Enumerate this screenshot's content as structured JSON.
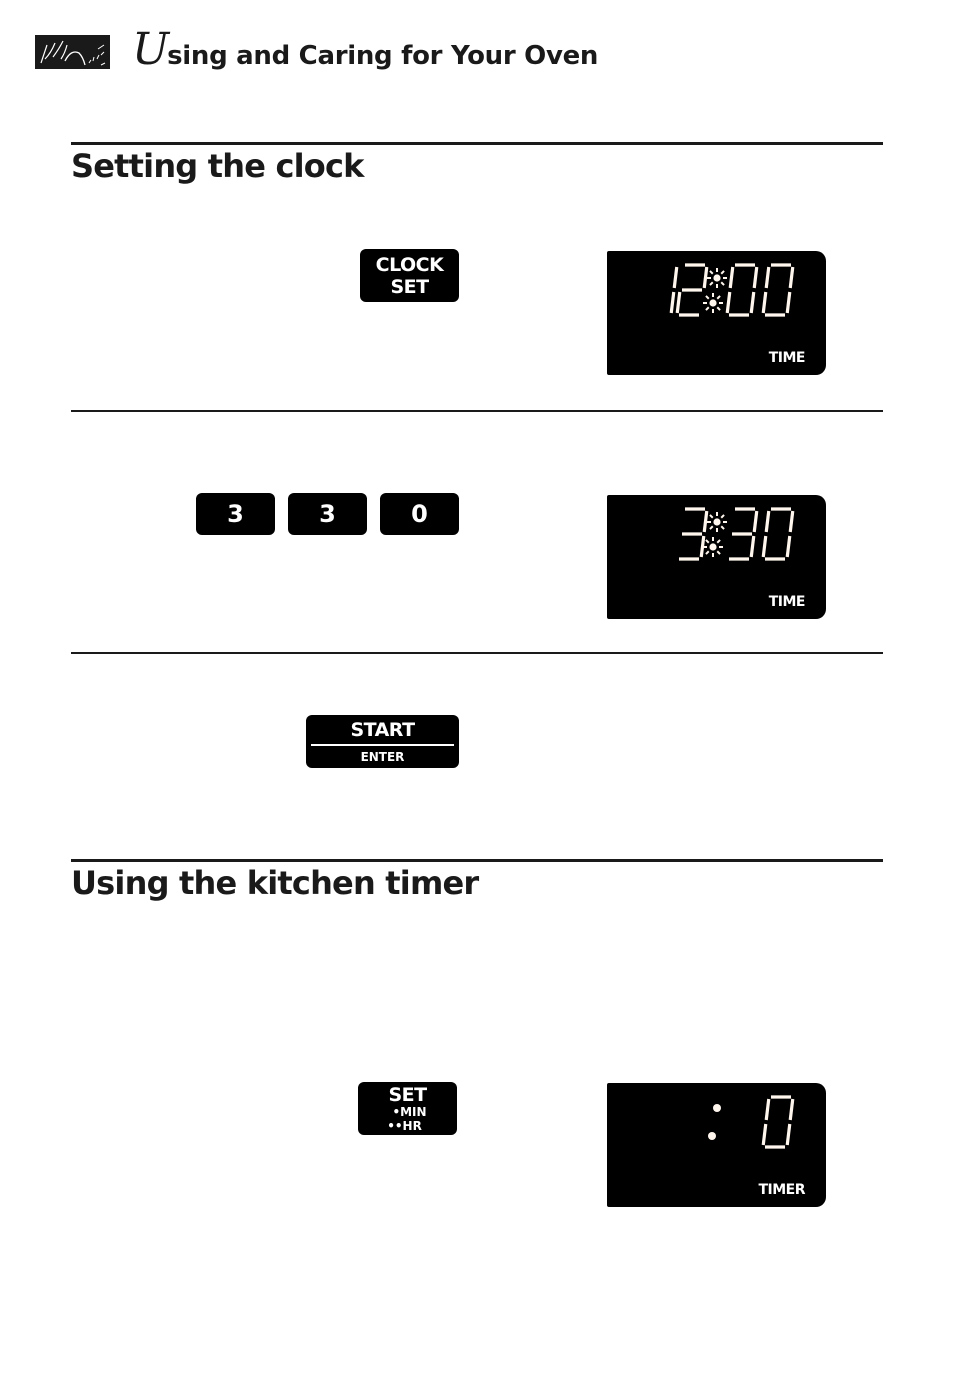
{
  "header": {
    "logo_icon": "decorative-brand-logo",
    "title_initial": "U",
    "title_rest": "sing and Caring for Your Oven"
  },
  "sections": [
    {
      "title": "Setting the clock",
      "steps": [
        {
          "keys": [
            {
              "label_lines": [
                "CLOCK",
                "SET"
              ]
            }
          ],
          "display": {
            "digits": "1200",
            "colon": "flashing",
            "mode_label": "TIME"
          }
        },
        {
          "keys": [
            {
              "label": "3"
            },
            {
              "label": "3"
            },
            {
              "label": "0"
            }
          ],
          "display": {
            "digits": "330",
            "colon": "flashing",
            "mode_label": "TIME"
          }
        },
        {
          "keys": [
            {
              "label_top": "START",
              "label_bottom": "ENTER"
            }
          ]
        }
      ]
    },
    {
      "title": "Using the kitchen timer",
      "steps": [
        {
          "keys": [
            {
              "label_top": "SET",
              "sub_labels": [
                "•MIN",
                "••HR"
              ]
            }
          ],
          "display": {
            "digits": "0",
            "colon": "steady",
            "mode_label": "TIMER"
          }
        }
      ]
    }
  ]
}
